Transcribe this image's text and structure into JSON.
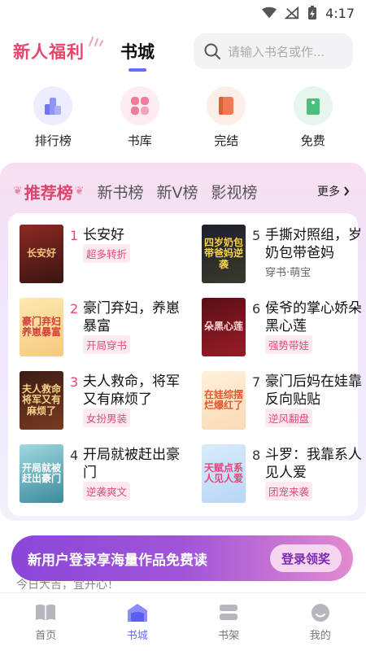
{
  "status_bar": {
    "time": "4:17"
  },
  "header": {
    "welfare_label": "新人福利",
    "tab_label": "书城",
    "search_placeholder": "请输入书名或作..."
  },
  "quick_nav": [
    {
      "label": "排行榜",
      "icon": "chart-icon",
      "color": "#7b82ef"
    },
    {
      "label": "书库",
      "icon": "grid-icon",
      "color": "#f07d9b"
    },
    {
      "label": "完结",
      "icon": "book-icon",
      "color": "#f07a52"
    },
    {
      "label": "免费",
      "icon": "tag-icon",
      "color": "#4cbf7f"
    }
  ],
  "rankings": {
    "active_tab": "推荐榜",
    "tabs": [
      "新书榜",
      "新V榜",
      "影视榜"
    ],
    "more_label": "更多"
  },
  "books": [
    {
      "rank": "1",
      "title": "长安好",
      "tag": "超多转折",
      "cover_text": "长安好"
    },
    {
      "rank": "5",
      "title": "手撕对照组，岁奶包带爸妈",
      "tag": "穿书·萌宝",
      "cover_text": "四岁奶包带爸妈逆袭"
    },
    {
      "rank": "2",
      "title": "豪门弃妇，养崽暴富",
      "tag": "开局穿书",
      "cover_text": "豪门弃妇养崽暴富"
    },
    {
      "rank": "6",
      "title": "侯爷的掌心娇朵黑心莲",
      "tag": "强势带娃",
      "cover_text": "朵黑心莲"
    },
    {
      "rank": "3",
      "title": "夫人救命，将军又有麻烦了",
      "tag": "女扮男装",
      "cover_text": "夫人救命将军又有麻烦了"
    },
    {
      "rank": "7",
      "title": "豪门后妈在娃靠反向贴贴",
      "tag": "逆风翻盘",
      "cover_text": "在娃综摆烂爆红了"
    },
    {
      "rank": "4",
      "title": "开局就被赶出豪门",
      "tag": "逆袭爽文",
      "cover_text": "开局就被赶出豪门"
    },
    {
      "rank": "8",
      "title": "斗罗：我靠系人见人爱",
      "tag": "团宠来袭",
      "cover_text": "天赋点系人见人爱"
    }
  ],
  "banner": {
    "text": "新用户登录享海量作品免费读",
    "button": "登录领奖",
    "greeting": "今日大吉，宜开心！"
  },
  "bottom_nav": [
    {
      "label": "首页",
      "icon": "home-book-icon",
      "active": false
    },
    {
      "label": "书城",
      "icon": "bookstore-icon",
      "active": true
    },
    {
      "label": "书架",
      "icon": "shelf-icon",
      "active": false
    },
    {
      "label": "我的",
      "icon": "profile-icon",
      "active": false
    }
  ],
  "colors": {
    "accent": "#6a6cf6",
    "pink": "#e9456a",
    "banner_start": "#8a47d8",
    "banner_end": "#e28bcf"
  }
}
